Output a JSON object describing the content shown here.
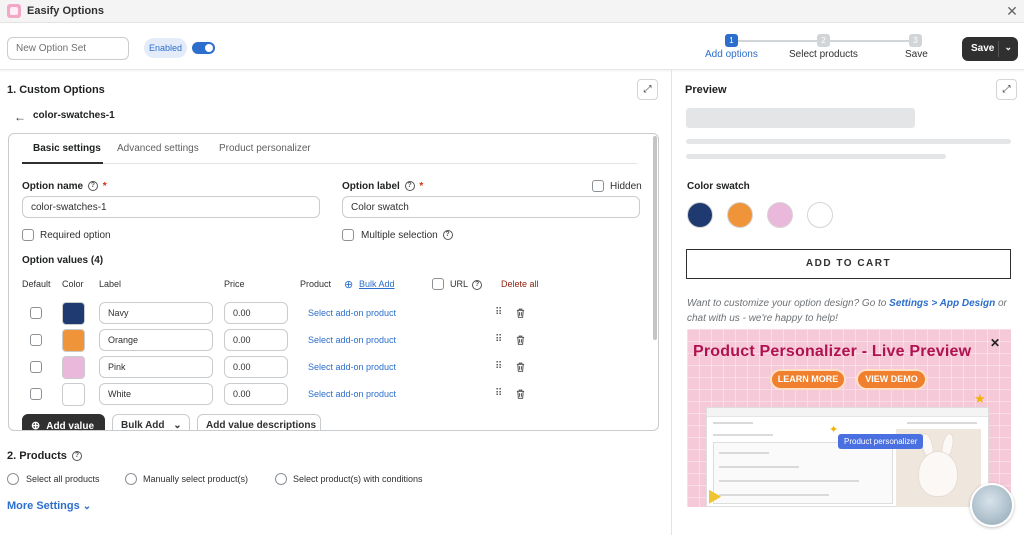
{
  "app": {
    "title": "Easify Options"
  },
  "topbar": {
    "option_set_placeholder": "New Option Set",
    "enabled_label": "Enabled",
    "steps": [
      {
        "num": "1",
        "label": "Add options",
        "active": true
      },
      {
        "num": "2",
        "label": "Select products",
        "active": false
      },
      {
        "num": "3",
        "label": "Save",
        "active": false
      }
    ],
    "save_label": "Save"
  },
  "custom_options": {
    "section_title": "1. Custom Options",
    "option_title": "color-swatches-1",
    "tabs": [
      "Basic settings",
      "Advanced settings",
      "Product personalizer"
    ],
    "option_name_label": "Option name",
    "option_name_value": "color-swatches-1",
    "option_label_label": "Option label",
    "option_label_value": "Color swatch",
    "hidden_label": "Hidden",
    "required_label": "Required option",
    "multiple_label": "Multiple selection",
    "values_title": "Option values (4)",
    "columns": {
      "default": "Default",
      "color": "Color",
      "label": "Label",
      "price": "Price",
      "product": "Product",
      "bulk_add": "Bulk Add",
      "url": "URL",
      "delete_all": "Delete all"
    },
    "rows": [
      {
        "color": "#1f3a70",
        "label": "Navy",
        "price": "0.00",
        "product_link": "Select add-on product"
      },
      {
        "color": "#f0943a",
        "label": "Orange",
        "price": "0.00",
        "product_link": "Select add-on product"
      },
      {
        "color": "#eab8da",
        "label": "Pink",
        "price": "0.00",
        "product_link": "Select add-on product"
      },
      {
        "color": "#ffffff",
        "label": "White",
        "price": "0.00",
        "product_link": "Select add-on product"
      }
    ],
    "buttons": {
      "add_value": "Add value",
      "bulk_add": "Bulk Add",
      "add_descriptions": "Add value descriptions"
    }
  },
  "products": {
    "section_title": "2. Products",
    "options": [
      "Select all products",
      "Manually select product(s)",
      "Select product(s) with conditions"
    ],
    "more_settings": "More Settings"
  },
  "preview": {
    "title": "Preview",
    "swatch_label": "Color swatch",
    "swatches": [
      "#1f3a70",
      "#f0943a",
      "#eab8da",
      "#ffffff"
    ],
    "add_to_cart": "ADD TO CART",
    "note_prefix": "Want to customize your option design? Go to ",
    "note_link1": "Settings > App Design",
    "note_mid": " or",
    "note_link2": "chat with us",
    "note_suffix": " - we're happy to help!",
    "promo": {
      "title": "Product Personalizer - Live Preview",
      "learn_more": "LEARN MORE",
      "view_demo": "VIEW DEMO",
      "badge": "Product personalizer"
    }
  },
  "colors": {
    "accent": "#2c6ecb",
    "dark": "#303030",
    "danger": "#8e1f0b",
    "promo_bg": "#f6c9d8",
    "promo_title": "#b0124f"
  }
}
